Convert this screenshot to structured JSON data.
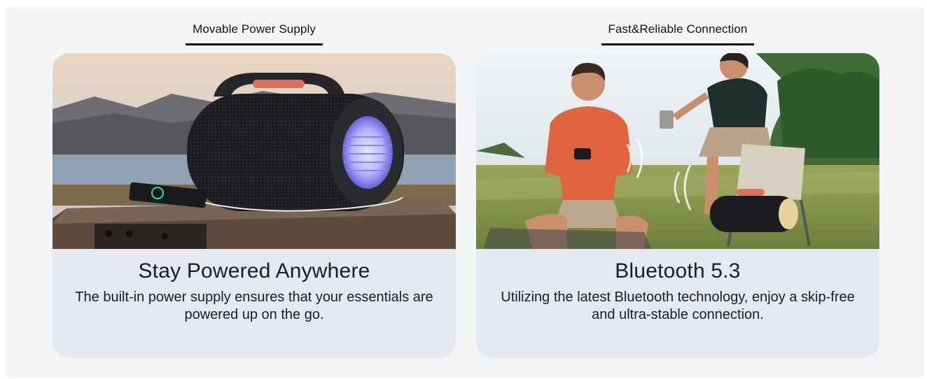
{
  "features": [
    {
      "tab_label": "Movable Power Supply",
      "heading": "Stay Powered Anywhere",
      "description": "The built-in power supply ensures that your essentials are powered up on the go.",
      "image_icon": "speaker-charging-phone-photo",
      "colors": {
        "speaker_body": "#1c1d20",
        "handle": "#d9745c",
        "lake": "#8fa2b4",
        "table": "#5e4b3e",
        "light": "#b8b4ff"
      }
    },
    {
      "tab_label": "Fast&Reliable Connection",
      "heading": "Bluetooth 5.3",
      "description": "Utilizing the latest Bluetooth technology, enjoy a skip-free and ultra-stable connection.",
      "image_icon": "people-camping-bluetooth-photo",
      "colors": {
        "grass": "#8b9a4f",
        "shirt_man": "#e0653f",
        "shirt_woman": "#1f2f2b",
        "sky": "#dce6ec"
      }
    }
  ],
  "colors": {
    "frame_bg": "#f4f5f7",
    "caption_bg": "#e5e8ef",
    "text": "#1b1d22"
  }
}
